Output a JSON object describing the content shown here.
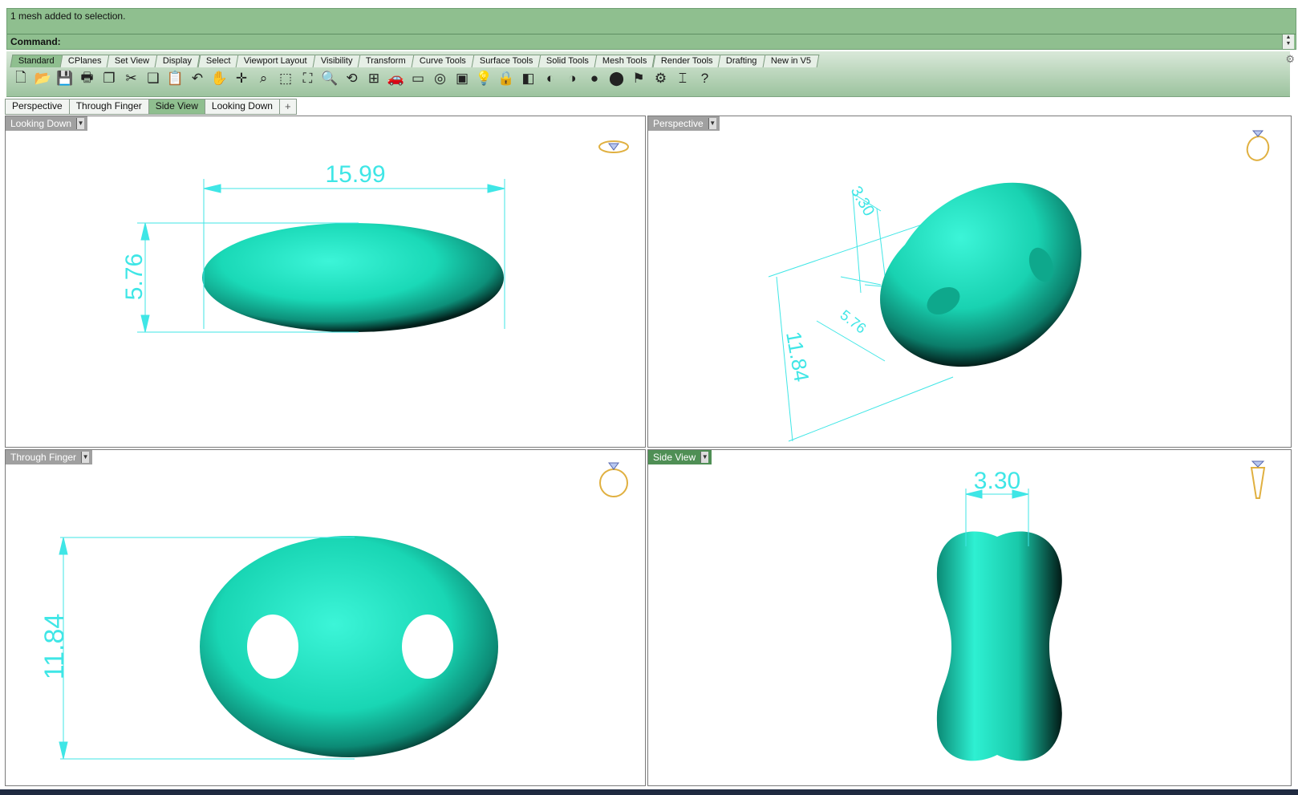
{
  "command": {
    "history": "1 mesh added to selection.",
    "prompt": "Command:",
    "scroll_up": "▲",
    "scroll_down": "▼"
  },
  "toolbar_tabs": [
    "Standard",
    "CPlanes",
    "Set View",
    "Display",
    "Select",
    "Viewport Layout",
    "Visibility",
    "Transform",
    "Curve Tools",
    "Surface Tools",
    "Solid Tools",
    "Mesh Tools",
    "Render Tools",
    "Drafting",
    "New in V5"
  ],
  "settings_glyph": "⚙",
  "toolbar_icons": [
    {
      "name": "new-file-icon",
      "glyph": "🗋"
    },
    {
      "name": "open-folder-icon",
      "glyph": "📂"
    },
    {
      "name": "save-icon",
      "glyph": "💾"
    },
    {
      "name": "print-icon",
      "glyph": "🖶"
    },
    {
      "name": "copy-to-clipboard-icon",
      "glyph": "❐"
    },
    {
      "name": "cut-icon",
      "glyph": "✂"
    },
    {
      "name": "copy-icon",
      "glyph": "❑"
    },
    {
      "name": "paste-icon",
      "glyph": "📋"
    },
    {
      "name": "undo-icon",
      "glyph": "↶"
    },
    {
      "name": "pan-hand-icon",
      "glyph": "✋"
    },
    {
      "name": "rotate-view-icon",
      "glyph": "✛"
    },
    {
      "name": "zoom-dynamic-icon",
      "glyph": "⌕"
    },
    {
      "name": "zoom-window-icon",
      "glyph": "⬚"
    },
    {
      "name": "zoom-extents-icon",
      "glyph": "⛶"
    },
    {
      "name": "zoom-selected-icon",
      "glyph": "🔍"
    },
    {
      "name": "undo-view-change-icon",
      "glyph": "⟲"
    },
    {
      "name": "four-viewports-icon",
      "glyph": "⊞"
    },
    {
      "name": "car-icon",
      "glyph": "🚗"
    },
    {
      "name": "named-view-icon",
      "glyph": "▭"
    },
    {
      "name": "object-snap-icon",
      "glyph": "◎"
    },
    {
      "name": "select-objects-icon",
      "glyph": "▣"
    },
    {
      "name": "light-bulb-icon",
      "glyph": "💡"
    },
    {
      "name": "lock-icon",
      "glyph": "🔒"
    },
    {
      "name": "layer-icon",
      "glyph": "◧"
    },
    {
      "name": "color-wheel-icon",
      "glyph": "◐"
    },
    {
      "name": "shade-sphere-icon",
      "glyph": "◑"
    },
    {
      "name": "rendered-sphere-icon",
      "glyph": "●"
    },
    {
      "name": "render-icon",
      "glyph": "⬤"
    },
    {
      "name": "flag-icon",
      "glyph": "⚑"
    },
    {
      "name": "options-gear-icon",
      "glyph": "⚙"
    },
    {
      "name": "dimension-icon",
      "glyph": "⌶"
    },
    {
      "name": "help-icon",
      "glyph": "?"
    }
  ],
  "viewport_tabs": [
    "Perspective",
    "Through Finger",
    "Side View",
    "Looking Down",
    "+"
  ],
  "viewports": {
    "looking_down": {
      "title": "Looking Down",
      "dim_width": "15.99",
      "dim_height": "5.76"
    },
    "perspective": {
      "title": "Perspective",
      "dim_a": "3.30",
      "dim_b": "5.76",
      "dim_c": "11.84"
    },
    "through_finger": {
      "title": "Through Finger",
      "dim_height": "11.84"
    },
    "side_view": {
      "title": "Side View",
      "dim_width": "3.30"
    }
  },
  "colors": {
    "command_bg": "#8fbf8f",
    "active_tab": "#4f8f55",
    "mesh": "#1fe8c4",
    "dimension": "#3fe6e6",
    "widget": "#e0b040"
  }
}
